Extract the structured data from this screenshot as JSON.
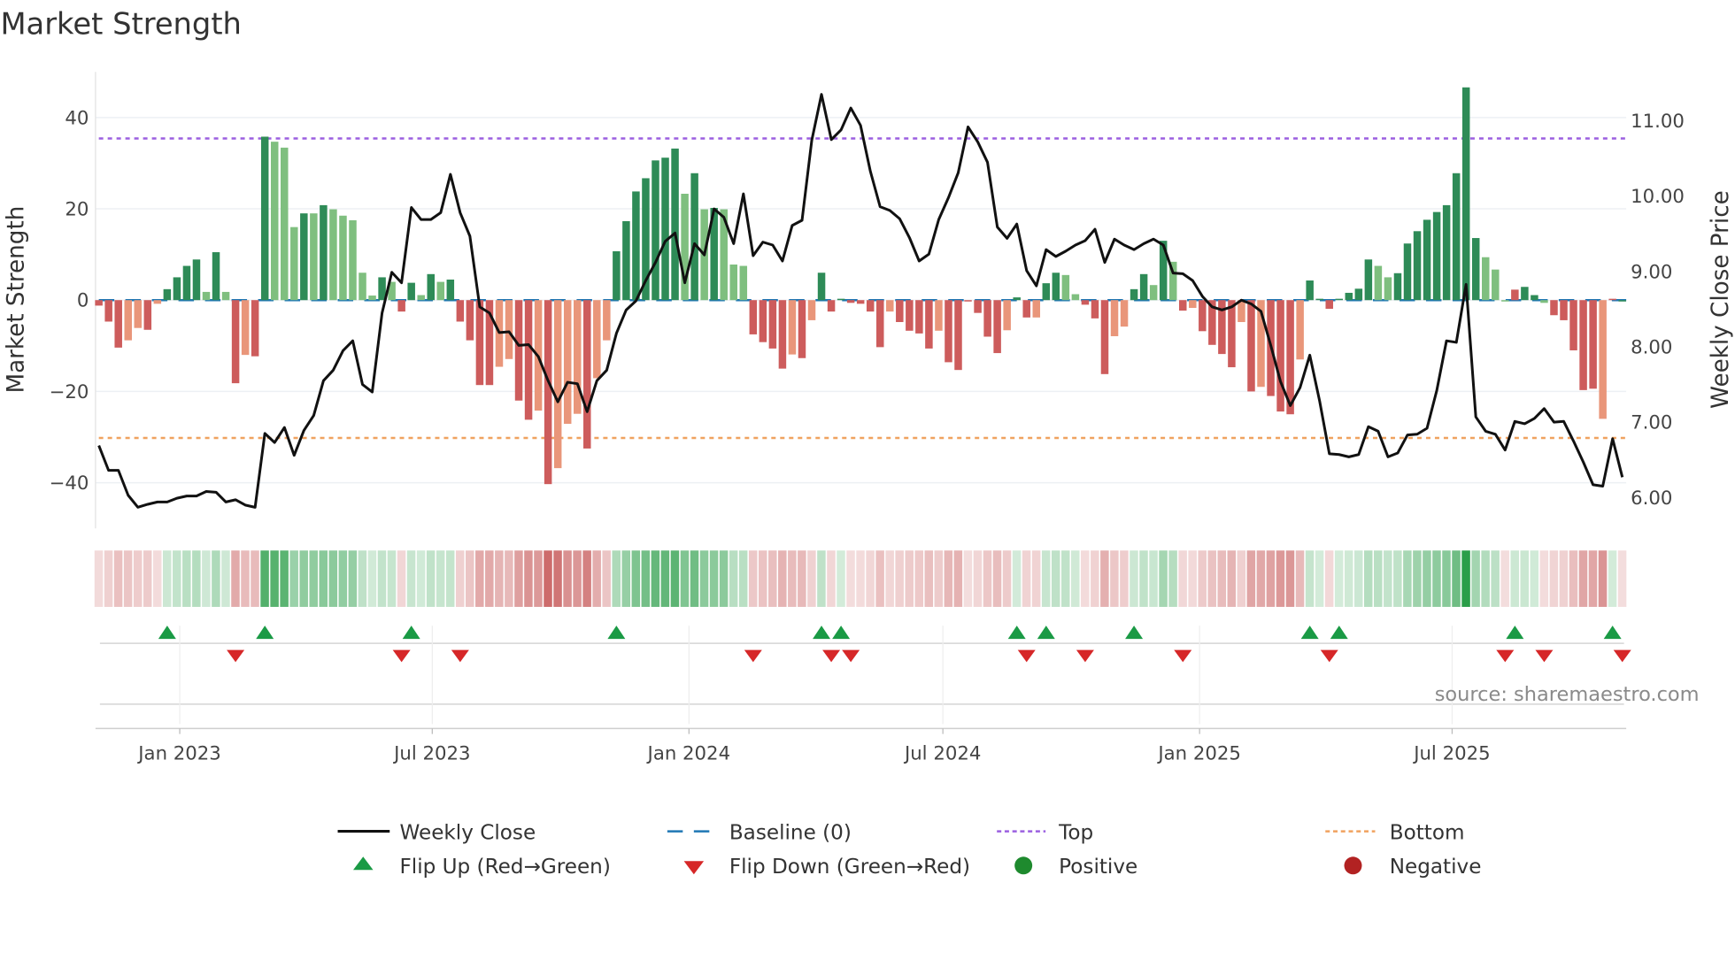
{
  "title": "Market Strength",
  "source": "source: sharemaestro.com",
  "legend": {
    "weekly_close": "Weekly Close",
    "baseline": "Baseline (0)",
    "top": "Top",
    "bottom": "Bottom",
    "flip_up": "Flip Up (Red→Green)",
    "flip_down": "Flip Down (Green→Red)",
    "positive": "Positive",
    "negative": "Negative"
  },
  "colors": {
    "strong_green": "#2e8b57",
    "light_green": "#7fbf7f",
    "strong_red": "#cd5c5c",
    "light_red": "#e9967a",
    "baseline": "#1f77b4",
    "top": "#9b5fe0",
    "bottom": "#f0a25f",
    "close": "#111111",
    "flip_up": "#1a9a45",
    "flip_down": "#d62728",
    "positive_dot": "#1e8a2e",
    "negative_dot": "#b22222"
  },
  "chart_data": {
    "type": "bar",
    "title": "Market Strength",
    "ylabel": "Market Strength",
    "y2label": "Weekly Close Price",
    "ylim": [
      -50,
      50
    ],
    "y2lim": [
      5.59,
      11.65
    ],
    "y_ticks": [
      "40",
      "20",
      "0",
      "−20",
      "−40"
    ],
    "y_tick_values": [
      40,
      20,
      0,
      -20,
      -40
    ],
    "y2_ticks": [
      "11.00",
      "10.00",
      "9.00",
      "8.00",
      "7.00",
      "6.00"
    ],
    "y2_tick_values": [
      11,
      10,
      9,
      8,
      7,
      6
    ],
    "x_ticks": [
      {
        "label": "Jan 2023",
        "date": "2023-01-01"
      },
      {
        "label": "Jul 2023",
        "date": "2023-07-01"
      },
      {
        "label": "Jan 2024",
        "date": "2024-01-01"
      },
      {
        "label": "Jul 2024",
        "date": "2024-07-01"
      },
      {
        "label": "Jan 2025",
        "date": "2025-01-01"
      },
      {
        "label": "Jul 2025",
        "date": "2025-07-01"
      }
    ],
    "start_date": "2022-11-04",
    "frequency": "weekly",
    "top_level": 35.4,
    "bottom_level": -30.2,
    "strength": [
      -1.2,
      -4.7,
      -10.4,
      -8.8,
      -6.1,
      -6.5,
      -0.8,
      2.4,
      5,
      7.5,
      8.9,
      1.8,
      10.5,
      1.8,
      -18.2,
      -12,
      -12.3,
      35.8,
      34.7,
      33.4,
      16,
      19,
      19,
      20.8,
      19.9,
      18.5,
      17.5,
      6,
      1,
      5,
      4,
      -2.5,
      3.8,
      1.1,
      5.7,
      4,
      4.5,
      -4.7,
      -8.8,
      -18.6,
      -18.6,
      -14.6,
      -12.9,
      -22,
      -26.2,
      -24.2,
      -40.3,
      -36.8,
      -27.1,
      -24.9,
      -32.5,
      -17.1,
      -8.8,
      10.7,
      17.3,
      23.8,
      26.7,
      30.6,
      31.2,
      33.2,
      23.3,
      27.8,
      19.9,
      20.2,
      19.9,
      7.8,
      7.5,
      -7.5,
      -9.2,
      -10.6,
      -15,
      -11.9,
      -12.7,
      -4.4,
      6,
      -2.5,
      0.3,
      -0.6,
      -0.8,
      -2.5,
      -10.3,
      -2.5,
      -4.8,
      -6.7,
      -7.3,
      -10.6,
      -6.7,
      -13.6,
      -15.3,
      -0.3,
      -2.8,
      -8,
      -11.6,
      -6.6,
      0.6,
      -3.8,
      -3.8,
      3.7,
      6,
      5.5,
      1.3,
      -1,
      -4,
      -16.2,
      -7.9,
      -5.8,
      2.4,
      5.7,
      3.3,
      13,
      8.4,
      -2.3,
      -1.7,
      -6.8,
      -9.8,
      -11.8,
      -14.7,
      -4.8,
      -20,
      -19,
      -21,
      -24.4,
      -25,
      -13,
      4.3,
      0.3,
      -1.9,
      0.3,
      1.6,
      2.5,
      8.9,
      7.5,
      5,
      5.9,
      12.4,
      15.1,
      17.6,
      19.3,
      20.8,
      27.8,
      46.6,
      13.6,
      9.4,
      6.7,
      -0.3,
      2.3,
      2.9,
      1.1,
      -0.6,
      -3.3,
      -4.4,
      -11,
      -19.7,
      -19.4,
      -26,
      0.3,
      -0.3
    ],
    "shade": "RRRrrRrGGGGgGgRrRGgggGgGgggggGgRGgGgGRRRRrrRRrRrrrRrrGGGGGGGgGgGgggRRRRrRrGRGRRRRrRRRRrRRRRRRrGRrGGggRRRrrGGgGgRrRRRRrRrRRRrGGRGGGGggGGGGGGGGGgggRGGgRRRRRrRGR",
    "close": [
      6.69,
      6.36,
      6.36,
      6.03,
      5.87,
      5.91,
      5.94,
      5.94,
      5.99,
      6.02,
      6.02,
      6.08,
      6.07,
      5.94,
      5.97,
      5.9,
      5.87,
      6.85,
      6.73,
      6.93,
      6.56,
      6.89,
      7.09,
      7.55,
      7.69,
      7.95,
      8.08,
      7.5,
      7.4,
      8.45,
      8.99,
      8.85,
      9.85,
      9.69,
      9.69,
      9.78,
      10.29,
      9.78,
      9.47,
      8.53,
      8.45,
      8.19,
      8.2,
      8.02,
      8.03,
      7.87,
      7.55,
      7.27,
      7.53,
      7.51,
      7.14,
      7.55,
      7.69,
      8.18,
      8.49,
      8.61,
      8.88,
      9.12,
      9.4,
      9.51,
      8.85,
      9.37,
      9.22,
      9.83,
      9.72,
      9.37,
      10.03,
      9.21,
      9.39,
      9.35,
      9.14,
      9.61,
      9.68,
      10.74,
      11.35,
      10.75,
      10.88,
      11.17,
      10.94,
      10.33,
      9.86,
      9.81,
      9.7,
      9.45,
      9.14,
      9.23,
      9.69,
      9.98,
      10.31,
      10.92,
      10.72,
      10.45,
      9.59,
      9.44,
      9.63,
      9.01,
      8.81,
      9.29,
      9.2,
      9.27,
      9.35,
      9.41,
      9.56,
      9.12,
      9.43,
      9.35,
      9.29,
      9.37,
      9.43,
      9.35,
      8.98,
      8.97,
      8.88,
      8.67,
      8.53,
      8.49,
      8.53,
      8.62,
      8.57,
      8.47,
      8.02,
      7.54,
      7.22,
      7.46,
      7.89,
      7.28,
      6.58,
      6.57,
      6.54,
      6.57,
      6.94,
      6.88,
      6.54,
      6.59,
      6.83,
      6.84,
      6.92,
      7.42,
      8.08,
      8.06,
      8.83,
      7.07,
      6.88,
      6.84,
      6.63,
      7.01,
      6.98,
      7.05,
      7.18,
      7.0,
      7.01,
      6.75,
      6.47,
      6.17,
      6.15,
      6.78,
      6.27
    ],
    "legend_position": "bottom"
  }
}
